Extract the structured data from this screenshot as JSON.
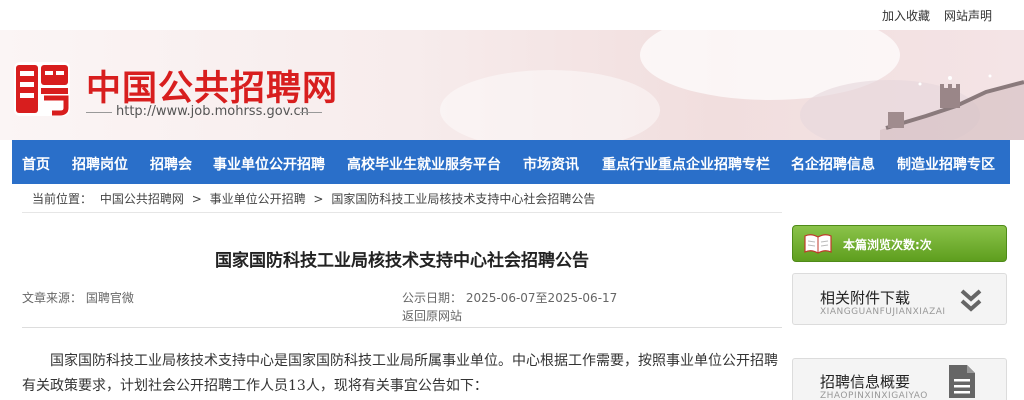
{
  "topbar": {
    "favorite": "加入收藏",
    "statement": "网站声明"
  },
  "header": {
    "site_name": "中国公共招聘网",
    "url": "http://www.job.mohrss.gov.cn"
  },
  "nav": {
    "items": [
      "首页",
      "招聘岗位",
      "招聘会",
      "事业单位公开招聘",
      "高校毕业生就业服务平台",
      "市场资讯",
      "重点行业重点企业招聘专栏",
      "名企招聘信息",
      "制造业招聘专区"
    ]
  },
  "breadcrumb": {
    "prefix": "当前位置：",
    "items": [
      "中国公共招聘网",
      "事业单位公开招聘",
      "国家国防科技工业局核技术支持中心社会招聘公告"
    ],
    "separator": ">"
  },
  "article": {
    "title": "国家国防科技工业局核技术支持中心社会招聘公告",
    "source": "文章来源：  国聘官微",
    "date": "公示日期：  2025-06-07至2025-06-17",
    "back": "返回原网站",
    "paragraph": "国家国防科技工业局核技术支持中心是国家国防科技工业局所属事业单位。中心根据工作需要，按照事业单位公开招聘有关政策要求，计划社会公开招聘工作人员13人，现将有关事宜公告如下："
  },
  "sidebar": {
    "views_label": "本篇浏览次数:次",
    "attachments": {
      "title": "相关附件下载",
      "pinyin": "XIANGGUANFUJIANXIAZAI"
    },
    "overview": {
      "title": "招聘信息概要",
      "pinyin": "ZHAOPINXINXIGAIYAO"
    }
  },
  "colors": {
    "nav_bg": "#2a6fc9",
    "brand_red": "#d81e1e",
    "views_green": "#6aa82a"
  }
}
